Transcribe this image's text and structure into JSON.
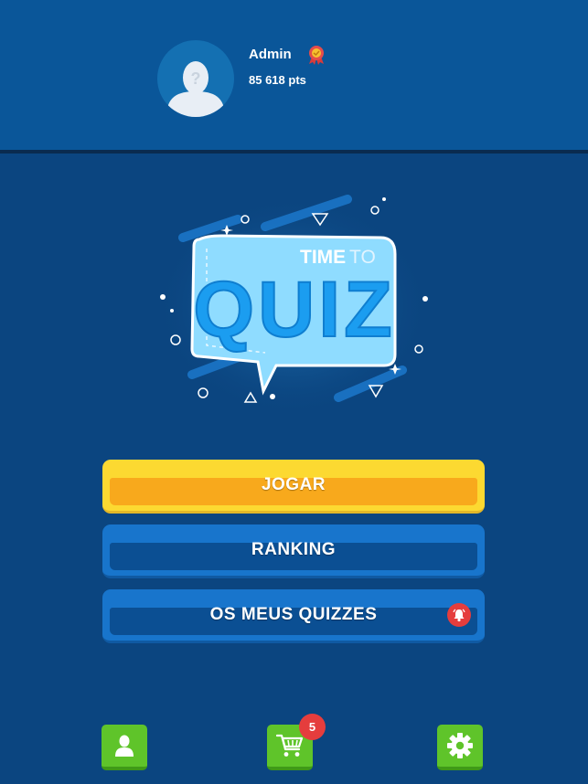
{
  "profile": {
    "username": "Admin",
    "points": "85 618 pts",
    "avatar_icon": "user-silhouette-question-icon",
    "badge_icon": "medal-icon"
  },
  "logo": {
    "line1_a": "TIME",
    "line1_b": "TO",
    "line2": "QUIZ"
  },
  "menu": {
    "play_label": "JOGAR",
    "ranking_label": "RANKING",
    "my_quizzes_label": "OS MEUS QUIZZES",
    "notification_icon": "bell-icon"
  },
  "bottom_nav": {
    "profile_icon": "user-icon",
    "shop_icon": "cart-icon",
    "cart_count": "5",
    "settings_icon": "gear-icon"
  },
  "colors": {
    "background": "#0b4580",
    "header": "#0a5699",
    "play_button": "#fcd931",
    "menu_button": "#1875cc",
    "nav_button": "#5fc42a",
    "notification": "#e53d3d"
  }
}
